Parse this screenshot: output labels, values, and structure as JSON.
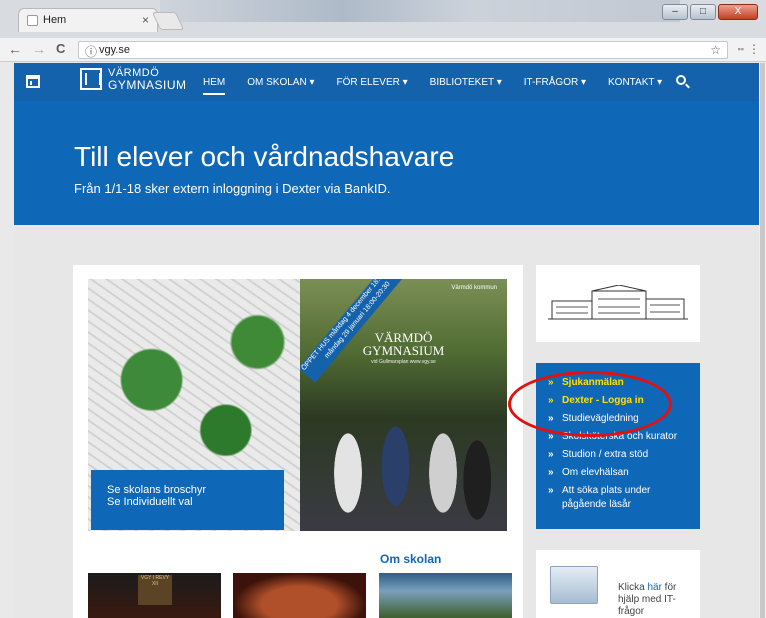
{
  "browser": {
    "tab_title": "Hem",
    "tab_close": "×",
    "url": "vgy.se",
    "info_icon": "ⓘ",
    "bookmark_star": "☆",
    "menu": "⋮",
    "back": "←",
    "forward": "→",
    "reload": "C",
    "window_controls": [
      "–",
      "□",
      "X"
    ]
  },
  "site": {
    "logo_line1": "VÄRMDÖ",
    "logo_line2": "GYMNASIUM",
    "nav": [
      {
        "label": "HEM"
      },
      {
        "label": "OM SKOLAN ▾"
      },
      {
        "label": "FÖR ELEVER ▾"
      },
      {
        "label": "BIBLIOTEKET ▾"
      },
      {
        "label": "IT-FRÅGOR ▾"
      },
      {
        "label": "KONTAKT ▾"
      }
    ],
    "hero_title": "Till elever och vårdnadshavare",
    "hero_subtitle": "Från 1/1-18 sker extern inloggning i Dexter via BankID.",
    "broschyr_line1": "Se skolans broschyr",
    "broschyr_line2": "Se Individuellt val",
    "poster": {
      "band": "ÖPPET HUS måndag 4 december 18:00-20:30 måndag 29 januari 18:00-20:30",
      "title_line1": "VÄRMDÖ",
      "title_line2": "GYMNASIUM",
      "sub": "vid Gullmarsplan www.vgy.se",
      "tag": "Värmdö kommun"
    },
    "om_skolan": "Om skolan",
    "thumb1_text": "VGY I REVY XII",
    "links": [
      {
        "arrow": "»",
        "label": "Sjukanmälan",
        "highlight": true
      },
      {
        "arrow": "»",
        "label": "Dexter - Logga in",
        "highlight": true
      },
      {
        "arrow": "»",
        "label": "Studievägledning",
        "highlight": false
      },
      {
        "arrow": "»",
        "label": "Skolsköterska och kurator",
        "highlight": false
      },
      {
        "arrow": "»",
        "label": "Studion / extra stöd",
        "highlight": false
      },
      {
        "arrow": "»",
        "label": "Om elevhälsan",
        "highlight": false
      },
      {
        "arrow": "»",
        "label": "Att söka plats under pågående läsår",
        "highlight": false
      }
    ],
    "help_pre": "Klicka ",
    "help_link": "här",
    "help_post": " för hjälp med IT-frågor"
  },
  "colors": {
    "brand_blue": "#0f67b8",
    "nav_blue": "#1462ab",
    "highlight_yellow": "#ffe100",
    "annotation_red": "#e31010"
  }
}
